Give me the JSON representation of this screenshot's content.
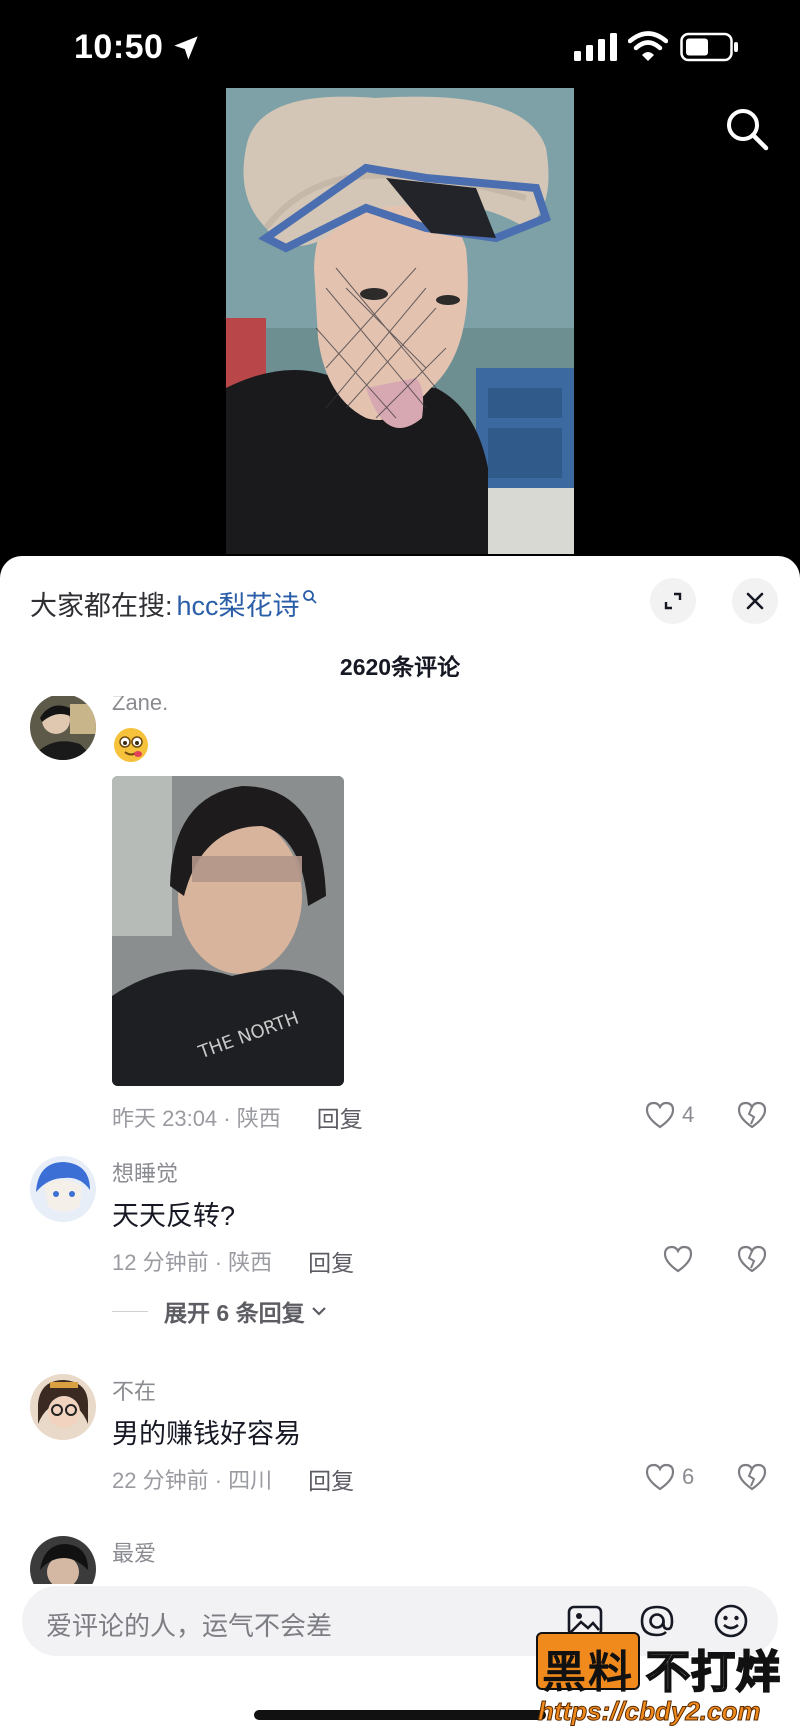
{
  "status_bar": {
    "time": "10:50",
    "icons": [
      "location-arrow-icon",
      "signal-icon",
      "wifi-icon",
      "battery-icon"
    ]
  },
  "video": {
    "search_icon": "search-icon"
  },
  "sheet": {
    "suggest_prefix": "大家都在搜:",
    "suggest_term": "hcc梨花诗",
    "comment_count": "2620条评论",
    "expand_icon": "expand-icon",
    "close_icon": "close-icon"
  },
  "comments": [
    {
      "user": "Zane.",
      "text": "",
      "has_emoji": true,
      "has_image": true,
      "time_location": "昨天 23:04 · 陕西",
      "reply_label": "回复",
      "likes": "4"
    },
    {
      "user": "想睡觉",
      "text": "天天反转?",
      "time_location": "12 分钟前 · 陕西",
      "reply_label": "回复",
      "likes": "",
      "expand_label": "展开 6 条回复"
    },
    {
      "user": "不在",
      "text": "男的赚钱好容易",
      "time_location": "22 分钟前 · 四川",
      "reply_label": "回复",
      "likes": "6"
    },
    {
      "user": "最爱",
      "text": ""
    }
  ],
  "input": {
    "placeholder": "爱评论的人，运气不会差",
    "icons": [
      "image-icon",
      "at-icon",
      "emoji-icon"
    ]
  },
  "watermark": {
    "brand_box": "黑料",
    "brand_text": "不打烊",
    "url": "https://cbdy2.com"
  },
  "colors": {
    "link_blue": "#2b5ea8",
    "text_primary": "#161823",
    "text_secondary": "#8a8b91",
    "watermark_orange": "#f08a1c"
  }
}
